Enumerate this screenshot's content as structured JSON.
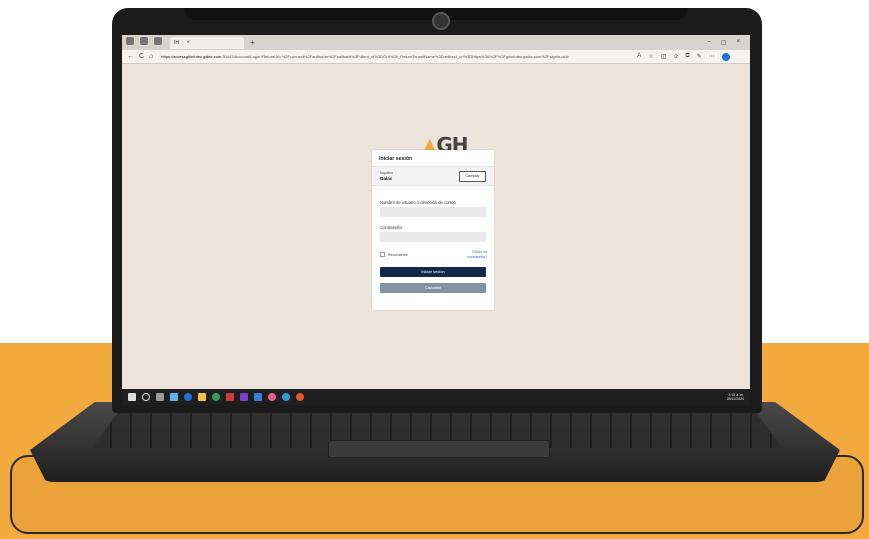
{
  "browser": {
    "tab_title": "IH",
    "tab_close": "×",
    "new_tab": "+",
    "win_controls": [
      "–",
      "▢",
      "×"
    ],
    "nav": [
      "←",
      "C",
      "⌂"
    ],
    "url_host": "https://accessghinfotec.galac.com",
    "url_rest": ":30443/Account/Login?ReturnUrl=%2Fconnect%2Fauthorize%2Fcallback%3Fclient_id%3DGHI%26_ReturnTenantName%3Dredirect_uri%3Dhttps%3A%2F%2Fghinfotec.galac.com%2Fsignin-oidc"
  },
  "logo": {
    "text": "GH",
    "accent": "#f2a93e"
  },
  "login": {
    "title": "Iniciar sesión",
    "tenant_label": "Inquilino",
    "tenant_value": "Galac",
    "change_button": "Cambiar",
    "username_label": "Nombre de usuario o dirección de correo",
    "password_label": "Contraseña",
    "remember_label": "Recordarme",
    "forgot_line1": "Olvidó su",
    "forgot_line2": "contraseña?",
    "signin_button": "Iniciar sesión",
    "cancel_button": "Cancelar"
  },
  "taskbar": {
    "time": "3:15 a. m.",
    "date": "28/11/2024"
  },
  "colors": {
    "primary_button": "#13294b",
    "secondary_button": "#8393a6",
    "page_background": "#ede5dc",
    "orange_background": "#f2a93e"
  }
}
